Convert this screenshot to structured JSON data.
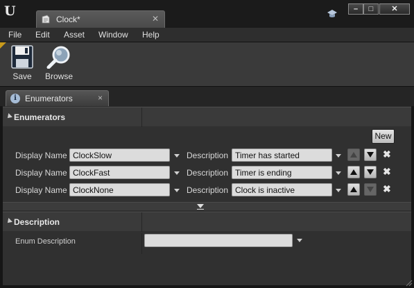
{
  "window": {
    "app_logo": "U",
    "tab_title": "Clock*",
    "tab_icon": "enum-asset-icon",
    "cap_icon": "graduation-cap-icon",
    "controls": {
      "minimize": "–",
      "maximize": "□",
      "close": "✕"
    }
  },
  "menu": {
    "items": [
      "File",
      "Edit",
      "Asset",
      "Window",
      "Help"
    ]
  },
  "toolbar": {
    "save_label": "Save",
    "browse_label": "Browse"
  },
  "panel_tab": {
    "icon": "i",
    "label": "Enumerators",
    "close": "×"
  },
  "enumerators": {
    "section_title": "Enumerators",
    "new_button": "New",
    "display_name_label": "Display Name",
    "description_label": "Description",
    "rows": [
      {
        "name": "ClockSlow",
        "description": "Timer has started",
        "up_enabled": false,
        "down_enabled": true
      },
      {
        "name": "ClockFast",
        "description": "Timer is ending",
        "up_enabled": true,
        "down_enabled": true
      },
      {
        "name": "ClockNone",
        "description": "Clock is inactive",
        "up_enabled": true,
        "down_enabled": false
      }
    ],
    "delete_glyph": "✖"
  },
  "description_section": {
    "title": "Description",
    "enum_description_label": "Enum Description",
    "enum_description_value": ""
  },
  "colors": {
    "accent_corner": "#c89a1c",
    "panel_bg": "#303030",
    "field_bg": "#dcdcdc"
  }
}
